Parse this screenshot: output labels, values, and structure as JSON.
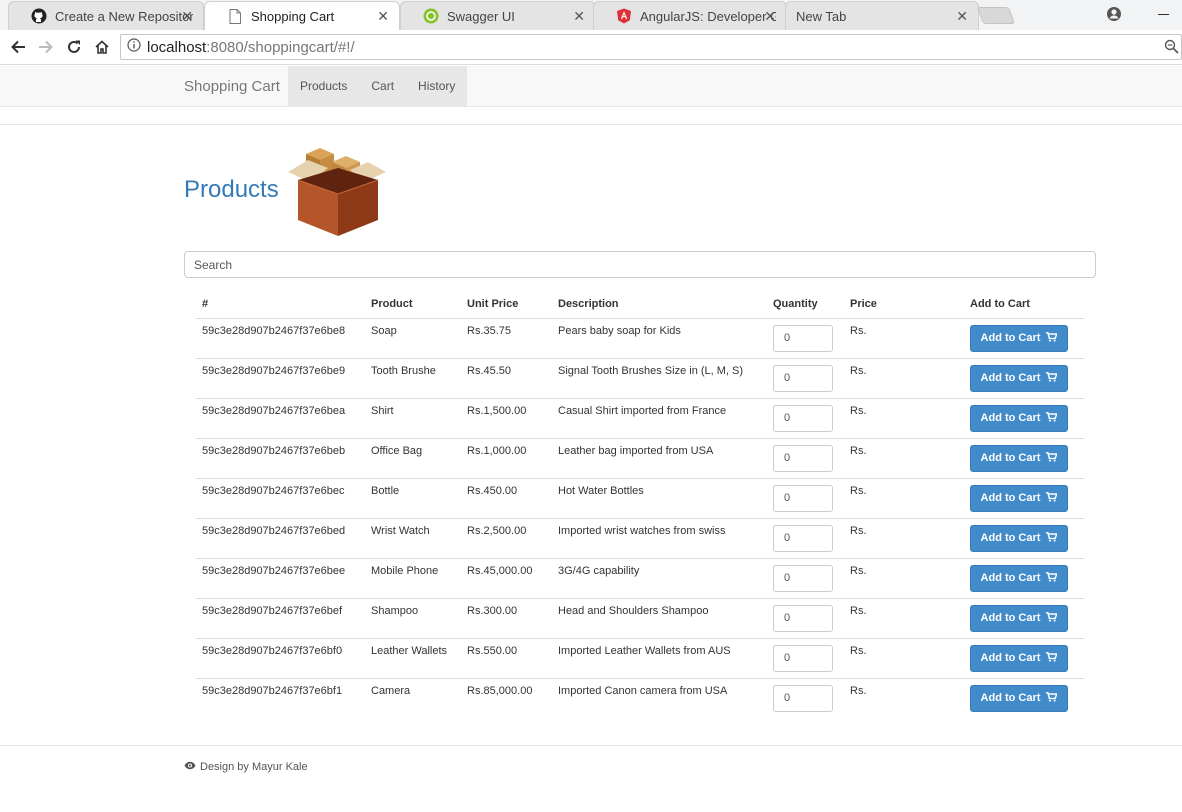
{
  "browser": {
    "tabs": [
      {
        "title": "Create a New Repository",
        "icon": "github-icon"
      },
      {
        "title": "Shopping Cart",
        "icon": "page-icon"
      },
      {
        "title": "Swagger UI",
        "icon": "swagger-icon"
      },
      {
        "title": "AngularJS: Developer Gu",
        "icon": "angular-icon"
      },
      {
        "title": "New Tab",
        "icon": ""
      }
    ],
    "close_glyph": "✕",
    "url_host": "localhost",
    "url_path": ":8080/shoppingcart/#!/"
  },
  "navbar": {
    "brand": "Shopping Cart",
    "links": [
      "Products",
      "Cart",
      "History"
    ]
  },
  "page": {
    "heading": "Products",
    "search_placeholder": "Search"
  },
  "table": {
    "headers": [
      "#",
      "Product",
      "Unit Price",
      "Description",
      "Quantity",
      "Price",
      "Add to Cart"
    ],
    "currency": "Rs.",
    "button_label": "Add to Cart",
    "rows": [
      {
        "id": "59c3e28d907b2467f37e6be8",
        "product": "Soap",
        "unit_price": "35.75",
        "description": "Pears baby soap for Kids",
        "quantity": "0"
      },
      {
        "id": "59c3e28d907b2467f37e6be9",
        "product": "Tooth Brushe",
        "unit_price": "45.50",
        "description": "Signal Tooth Brushes Size in (L, M, S)",
        "quantity": "0"
      },
      {
        "id": "59c3e28d907b2467f37e6bea",
        "product": "Shirt",
        "unit_price": "1,500.00",
        "description": "Casual Shirt imported from France",
        "quantity": "0"
      },
      {
        "id": "59c3e28d907b2467f37e6beb",
        "product": "Office Bag",
        "unit_price": "1,000.00",
        "description": "Leather bag imported from USA",
        "quantity": "0"
      },
      {
        "id": "59c3e28d907b2467f37e6bec",
        "product": "Bottle",
        "unit_price": "450.00",
        "description": "Hot Water Bottles",
        "quantity": "0"
      },
      {
        "id": "59c3e28d907b2467f37e6bed",
        "product": "Wrist Watch",
        "unit_price": "2,500.00",
        "description": "Imported wrist watches from swiss",
        "quantity": "0"
      },
      {
        "id": "59c3e28d907b2467f37e6bee",
        "product": "Mobile Phone",
        "unit_price": "45,000.00",
        "description": "3G/4G capability",
        "quantity": "0"
      },
      {
        "id": "59c3e28d907b2467f37e6bef",
        "product": "Shampoo",
        "unit_price": "300.00",
        "description": "Head and Shoulders Shampoo",
        "quantity": "0"
      },
      {
        "id": "59c3e28d907b2467f37e6bf0",
        "product": "Leather Wallets",
        "unit_price": "550.00",
        "description": "Imported Leather Wallets from AUS",
        "quantity": "0"
      },
      {
        "id": "59c3e28d907b2467f37e6bf1",
        "product": "Camera",
        "unit_price": "85,000.00",
        "description": "Imported Canon camera from USA",
        "quantity": "0"
      }
    ]
  },
  "footer": {
    "text": "Design by Mayur Kale"
  },
  "colors": {
    "accent": "#337ab7",
    "button": "#428bca"
  }
}
